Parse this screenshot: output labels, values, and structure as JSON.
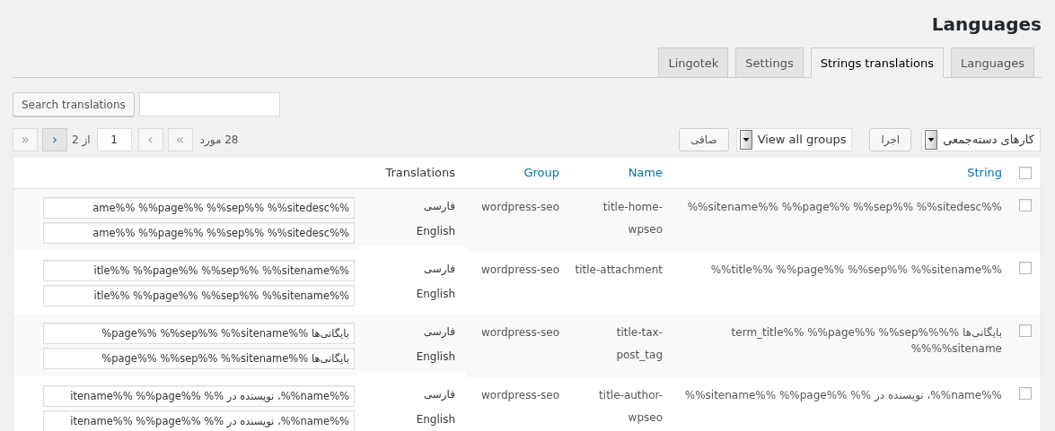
{
  "page_title": "Languages",
  "tabs": [
    {
      "label": "Languages",
      "selected": false
    },
    {
      "label": "Strings translations",
      "selected": true
    },
    {
      "label": "Settings",
      "selected": false
    },
    {
      "label": "Lingotek",
      "selected": false
    }
  ],
  "search": {
    "button": "Search translations"
  },
  "bulk_actions": {
    "select": "کارهای دسته‌جمعی",
    "apply": "اجرا"
  },
  "group_filter": {
    "select": "View all groups",
    "filter": "صافی"
  },
  "pagination": {
    "count": "28 مورد",
    "items": [
      {
        "kind": "button",
        "symbol": "»",
        "disabled": true
      },
      {
        "kind": "button",
        "symbol": "›",
        "disabled": true
      },
      {
        "kind": "input",
        "value": "1"
      },
      {
        "kind": "text",
        "text": "از 2"
      },
      {
        "kind": "button",
        "symbol": "‹",
        "disabled": false
      },
      {
        "kind": "button",
        "symbol": "«",
        "disabled": true
      }
    ]
  },
  "table": {
    "select_all_checked": false,
    "columns": [
      {
        "label": "String",
        "sortable": true
      },
      {
        "label": "Name",
        "sortable": true
      },
      {
        "label": "Group",
        "sortable": true
      },
      {
        "label": "Translations",
        "sortable": false
      }
    ],
    "rows": [
      {
        "checked": false,
        "string": "%%sitename%% %%page%% %%sep%% %%sitedesc%%",
        "name": "title-home-wpseo",
        "group": "wordpress-seo",
        "translations": [
          {
            "language": "فارسی",
            "value": "ame%% %%page%% %%sep%% %%sitedesc%%"
          },
          {
            "language": "English",
            "value": "ame%% %%page%% %%sep%% %%sitedesc%%"
          }
        ]
      },
      {
        "checked": false,
        "string": "%%title%% %%page%% %%sep%% %%sitename%%",
        "name": "title-attachment",
        "group": "wordpress-seo",
        "translations": [
          {
            "language": "فارسی",
            "value": "itle%% %%page%% %%sep%% %%sitename%%"
          },
          {
            "language": "English",
            "value": "itle%% %%page%% %%sep%% %%sitename%%"
          }
        ]
      },
      {
        "checked": false,
        "string": "term_title%% %%page%% %%sep%%%% بایگانی‌ها %%%%sitename",
        "name": "title-tax-post_tag",
        "group": "wordpress-seo",
        "translations": [
          {
            "language": "فارسی",
            "value": "%page%% %%sep%% %%sitename%% بایگانی‌ها"
          },
          {
            "language": "English",
            "value": "%page%% %%sep%% %%sitename%% بایگانی‌ها"
          }
        ]
      },
      {
        "checked": false,
        "string": "%%sitename%% %%page%% %% نویسنده در ،%%name%%",
        "name": "title-author-wpseo",
        "group": "wordpress-seo",
        "translations": [
          {
            "language": "فارسی",
            "value": "itename%% %%page%% %% نویسنده در ،%%name%%"
          },
          {
            "language": "English",
            "value": "itename%% %%page%% %% نویسنده در ،%%name%%"
          }
        ]
      }
    ]
  }
}
